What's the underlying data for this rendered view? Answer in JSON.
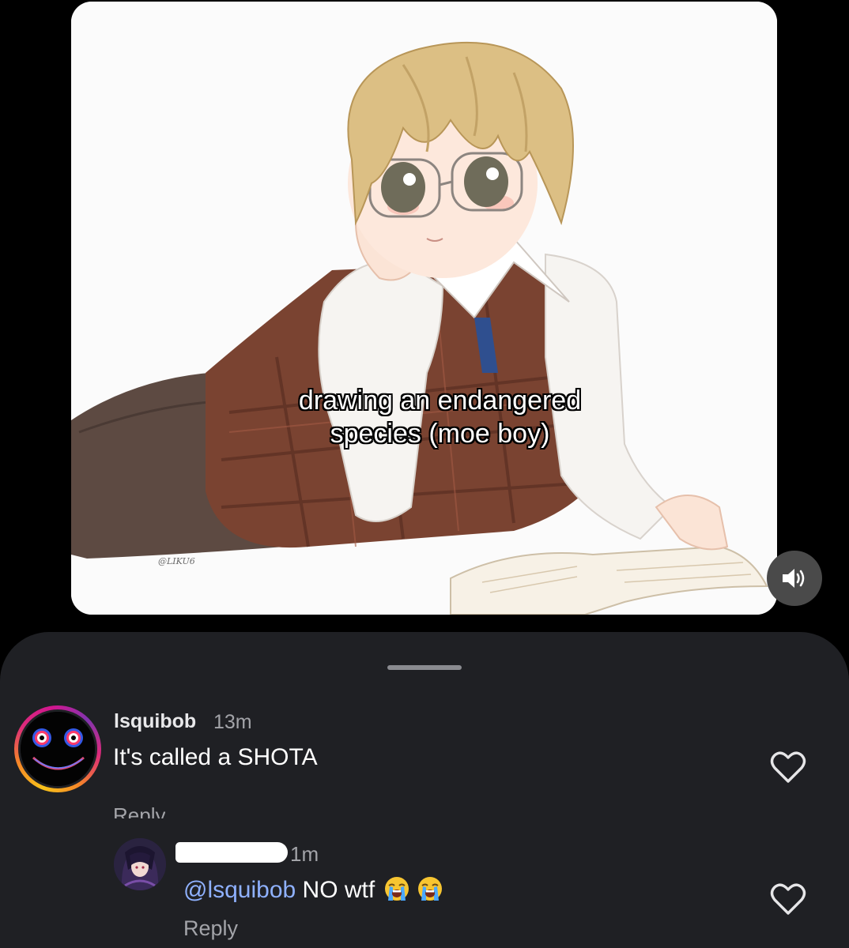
{
  "video": {
    "caption_line1": "drawing an endangered",
    "caption_line2": "species (moe boy)",
    "watermark": "@LIKU6",
    "volume_icon": "volume-on-icon"
  },
  "comments": [
    {
      "username": "lsquibob",
      "time": "13m",
      "text": "It's called a SHOTA",
      "reply_label": "Reply",
      "like_icon": "heart-outline-icon"
    },
    {
      "username": "",
      "time": "1m",
      "mention": "@lsquibob",
      "text": " NO wtf",
      "emojis": [
        "loudly-crying-face",
        "loudly-crying-face"
      ],
      "reply_label": "Reply",
      "like_icon": "heart-outline-icon"
    }
  ],
  "colors": {
    "background": "#000000",
    "sheet": "#1f2024",
    "mention": "#8fb1ff",
    "muted_text": "#a3a4a9"
  }
}
